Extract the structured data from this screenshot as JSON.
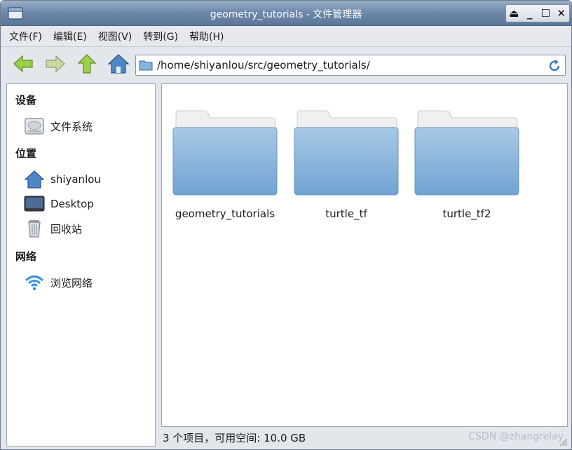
{
  "window": {
    "title": "geometry_tutorials - 文件管理器"
  },
  "title_buttons": {
    "eject": "⏏",
    "minimize": "_",
    "maximize": "☐",
    "close": "✕"
  },
  "menu": [
    {
      "label": "文件(F)",
      "id": "file"
    },
    {
      "label": "编辑(E)",
      "id": "edit"
    },
    {
      "label": "视图(V)",
      "id": "view"
    },
    {
      "label": "转到(G)",
      "id": "goto"
    },
    {
      "label": "帮助(H)",
      "id": "help"
    }
  ],
  "location": {
    "path": "/home/shiyanlou/src/geometry_tutorials/"
  },
  "sidebar": {
    "devices_header": "设备",
    "filesystem": "文件系统",
    "places_header": "位置",
    "home": "shiyanlou",
    "desktop": "Desktop",
    "trash": "回收站",
    "network_header": "网络",
    "browse_network": "浏览网络"
  },
  "folders": [
    {
      "name": "geometry_tutorials"
    },
    {
      "name": "turtle_tf"
    },
    {
      "name": "turtle_tf2"
    }
  ],
  "status": {
    "text": "3 个项目，可用空间: 10.0 GB"
  },
  "watermark": "CSDN @zhangrelay",
  "colors": {
    "titlebar": "#6f8aac",
    "folder_blue": "#7faed6",
    "nav_green": "#8dc63f"
  },
  "icons": {
    "back": "arrow-left-icon",
    "forward": "arrow-right-icon",
    "up": "arrow-up-icon",
    "home": "home-icon",
    "reload": "reload-icon",
    "drive": "drive-icon",
    "desktop": "desktop-icon",
    "trash": "trash-icon",
    "network": "wifi-icon"
  }
}
